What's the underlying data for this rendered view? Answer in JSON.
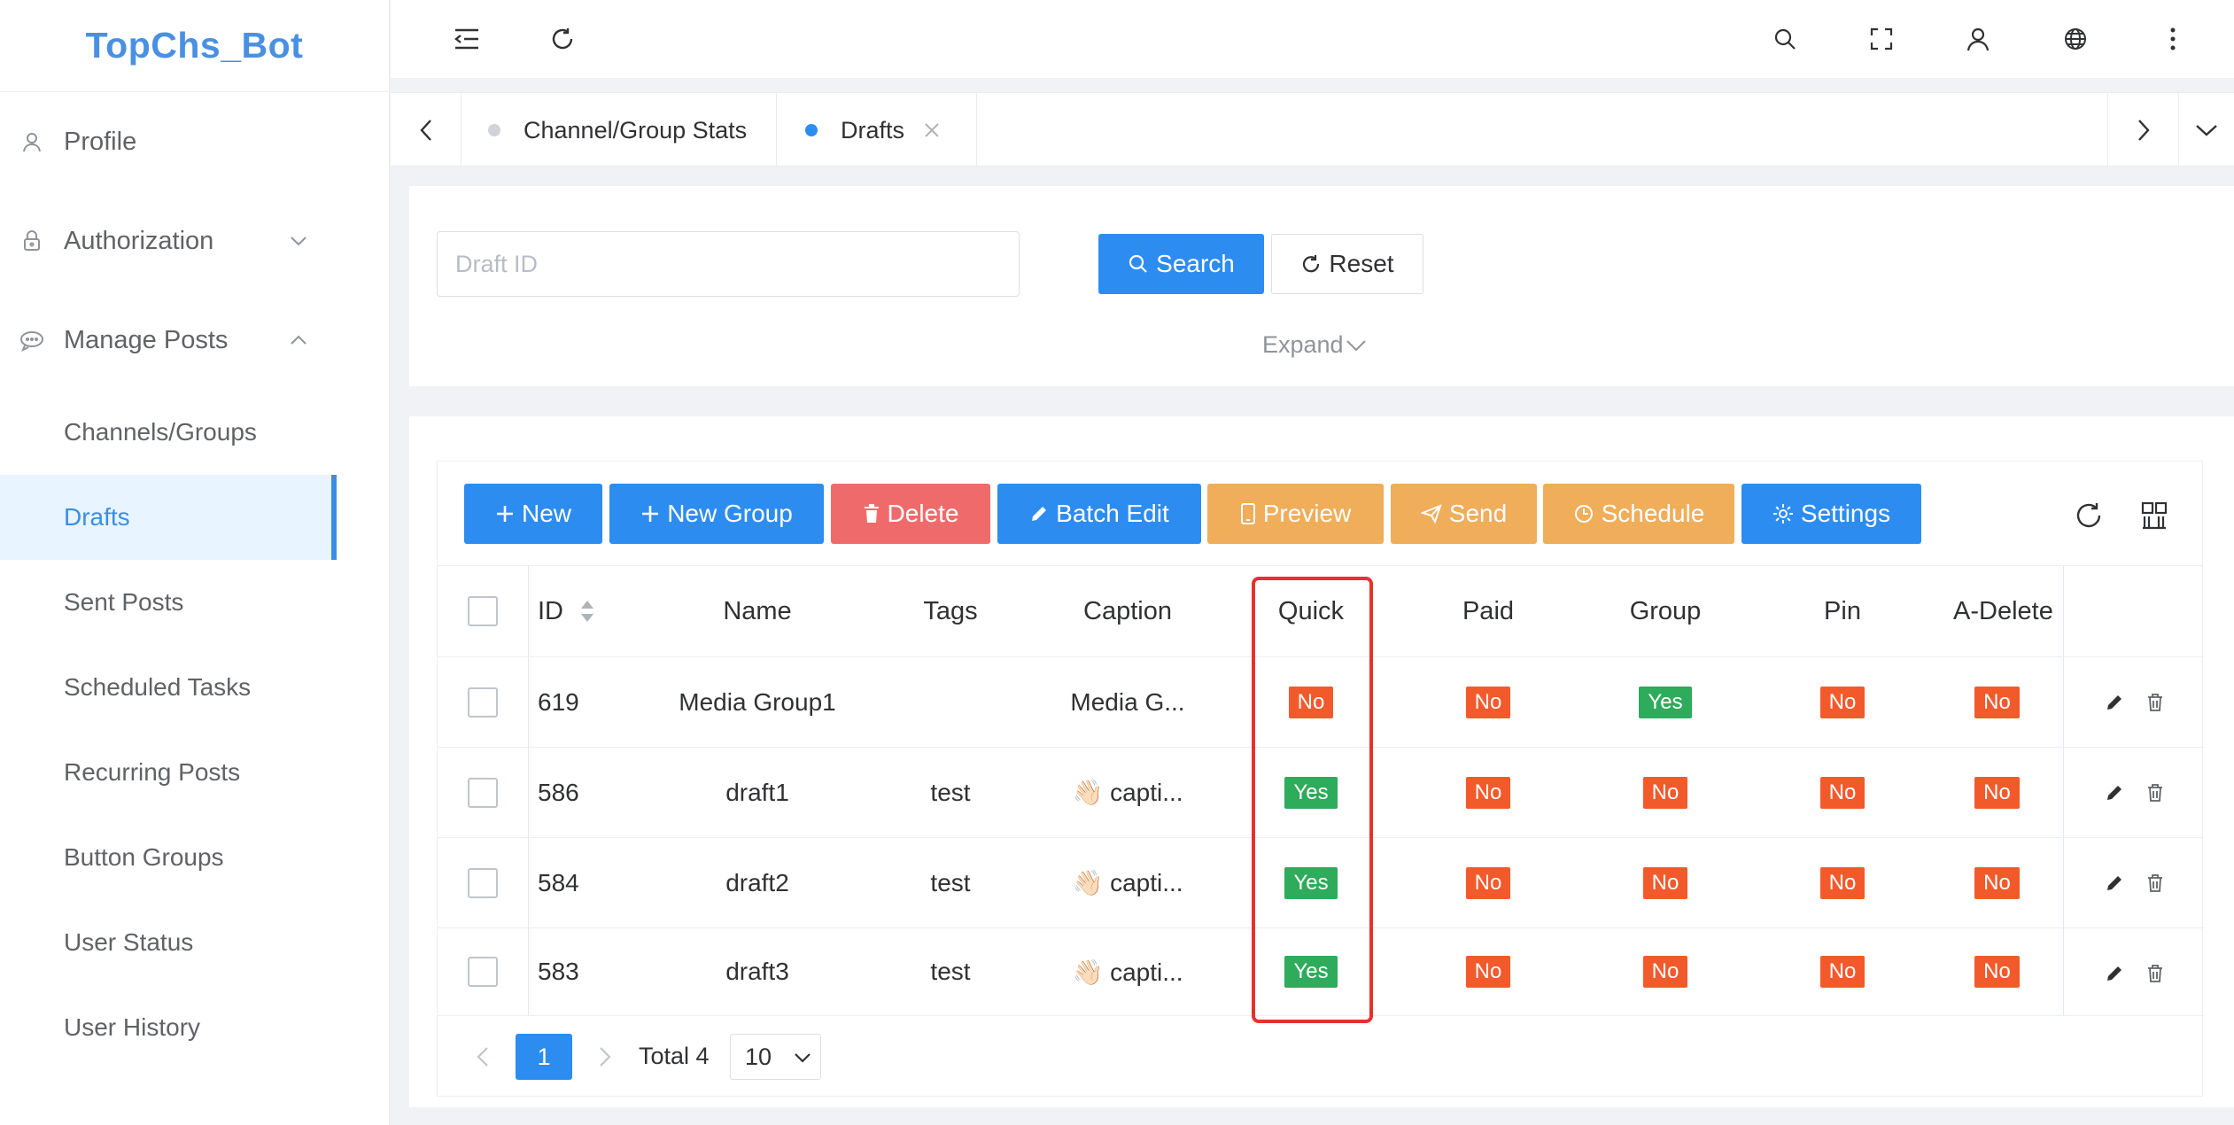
{
  "app": {
    "brand": "TopChs_Bot"
  },
  "sidebar": {
    "items": [
      {
        "label": "Profile",
        "icon": "user-icon"
      },
      {
        "label": "Authorization",
        "icon": "lock-icon"
      },
      {
        "label": "Manage Posts",
        "icon": "chat-icon"
      }
    ],
    "submenu": [
      {
        "label": "Channels/Groups"
      },
      {
        "label": "Drafts",
        "active": true
      },
      {
        "label": "Sent Posts"
      },
      {
        "label": "Scheduled Tasks"
      },
      {
        "label": "Recurring Posts"
      },
      {
        "label": "Button Groups"
      },
      {
        "label": "User Status"
      },
      {
        "label": "User History"
      }
    ]
  },
  "tabs": [
    {
      "label": "Channel/Group Stats",
      "active": false
    },
    {
      "label": "Drafts",
      "active": true
    }
  ],
  "search": {
    "placeholder": "Draft ID",
    "search_label": "Search",
    "reset_label": "Reset",
    "expand_label": "Expand"
  },
  "toolbar": {
    "new_label": "New",
    "new_group_label": "New Group",
    "delete_label": "Delete",
    "batch_edit_label": "Batch Edit",
    "preview_label": "Preview",
    "send_label": "Send",
    "schedule_label": "Schedule",
    "settings_label": "Settings"
  },
  "table": {
    "columns": [
      "ID",
      "Name",
      "Tags",
      "Caption",
      "Quick",
      "Paid",
      "Group",
      "Pin",
      "A-Delete"
    ],
    "rows": [
      {
        "id": "619",
        "name": "Media Group1",
        "tags": "",
        "caption": "Media G...",
        "quick": "No",
        "paid": "No",
        "group": "Yes",
        "pin": "No",
        "adelete": "No"
      },
      {
        "id": "586",
        "name": "draft1",
        "tags": "test",
        "caption": "👋🏻 capti...",
        "quick": "Yes",
        "paid": "No",
        "group": "No",
        "pin": "No",
        "adelete": "No"
      },
      {
        "id": "584",
        "name": "draft2",
        "tags": "test",
        "caption": "👋🏻 capti...",
        "quick": "Yes",
        "paid": "No",
        "group": "No",
        "pin": "No",
        "adelete": "No"
      },
      {
        "id": "583",
        "name": "draft3",
        "tags": "test",
        "caption": "👋🏻 capti...",
        "quick": "Yes",
        "paid": "No",
        "group": "No",
        "pin": "No",
        "adelete": "No"
      }
    ]
  },
  "pagination": {
    "current_page": "1",
    "total_label": "Total 4",
    "page_size": "10"
  },
  "colors": {
    "primary": "#2d8cf0",
    "danger": "#ef6b6b",
    "warning": "#f0ad5a",
    "badge_no": "#f25a2c",
    "badge_yes": "#2eab5b",
    "highlight": "#e8312b"
  }
}
